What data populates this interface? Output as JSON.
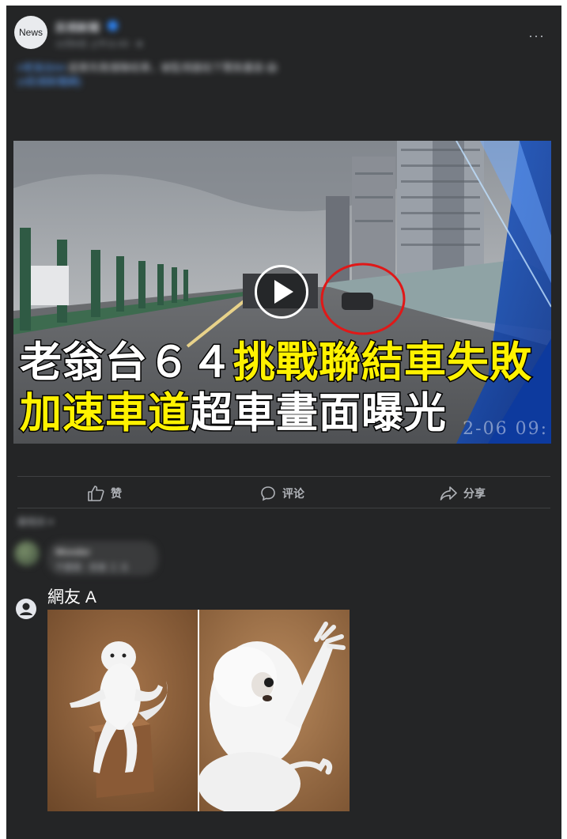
{
  "post": {
    "avatar_label": "News",
    "page_name": "民視新聞",
    "meta": "12月6日 上午11:43 · ⊕",
    "more_label": "···",
    "caption_tag": "#老翁台64",
    "caption_body": "超車失敗撞聯結車，被監視器拍下驚險畫面 😱",
    "caption_link": "(#民視新聞網)"
  },
  "video": {
    "title_line1_white": "老翁台６４",
    "title_line1_yellow": "挑戰聯結車失敗",
    "title_line2_yellow": "加速車道",
    "title_line2_white": "超車畫面曝光",
    "timestamp": "2-06 09:"
  },
  "actions": {
    "like": "赞",
    "comment": "评论",
    "share": "分享"
  },
  "comments": {
    "sort_label": "最相关 ▾",
    "first_name": "Wonder",
    "first_text": "不要跟 · 很會 工 五",
    "second_name": "網友 A"
  },
  "icons": {
    "like": "thumbs-up-icon",
    "comment": "comment-bubble-icon",
    "share": "share-arrow-icon",
    "play": "play-icon",
    "user": "user-avatar-icon"
  },
  "colors": {
    "card_bg": "#242526",
    "title_yellow": "#fff200",
    "link_blue": "#2d88ff"
  }
}
